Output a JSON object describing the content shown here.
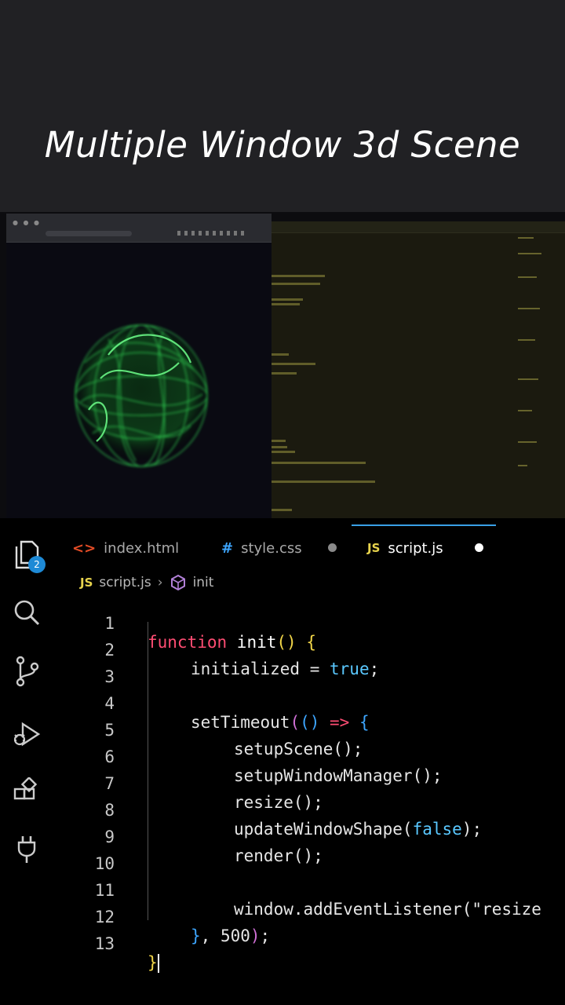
{
  "title": "Multiple Window 3d Scene",
  "colors": {
    "accent": "#39a0e6",
    "sphere": "#2ec94f",
    "keyword": "#ff4d73",
    "boolean": "#5ac8ff"
  },
  "preview": {
    "browser_icons": [
      "window-dots-icon",
      "url-bar-icon"
    ],
    "object": "green-particle-sphere-icon"
  },
  "editor": {
    "activity_icons": [
      "files-icon",
      "search-icon",
      "source-control-icon",
      "run-debug-icon",
      "extensions-icon",
      "plug-icon"
    ],
    "explorer_badge": "2",
    "tabs": [
      {
        "label": "index.html",
        "icon": "<>",
        "icon_color": "#e34c26",
        "dirty": false
      },
      {
        "label": "style.css",
        "icon": "#",
        "icon_color": "#3da6ff",
        "dirty": true,
        "dot_color": "#8a8a8a"
      },
      {
        "label": "script.js",
        "icon": "JS",
        "icon_color": "#e8d44d",
        "dirty": true,
        "dot_color": "#ffffff",
        "active": true
      }
    ],
    "breadcrumb": {
      "file": "script.js",
      "symbol": "init",
      "file_icon": "JS"
    },
    "line_numbers": [
      "1",
      "2",
      "3",
      "4",
      "5",
      "6",
      "7",
      "8",
      "9",
      "10",
      "11",
      "12",
      "13"
    ],
    "code": {
      "l1_kw": "function",
      "l1_name": " init",
      "l1_paren": "()",
      "l1_rest": " ",
      "l1_brace": "{",
      "l2_a": "initialized = ",
      "l2_bool": "true",
      "l2_end": ";",
      "l4_name": "setTimeout",
      "l4_p1": "(",
      "l4_p2": "()",
      "l4_arrow": " => ",
      "l4_brace": "{",
      "l5": "setupScene();",
      "l6": "setupWindowManager();",
      "l7": "resize();",
      "l8_a": "updateWindowShape(",
      "l8_bool": "false",
      "l8_b": ");",
      "l9": "render();",
      "l11": "window.addEventListener(\"resize",
      "l12_brace": "}",
      "l12_rest": ", 500",
      "l12_paren": ")",
      "l12_end": ";",
      "l13": "}"
    }
  }
}
